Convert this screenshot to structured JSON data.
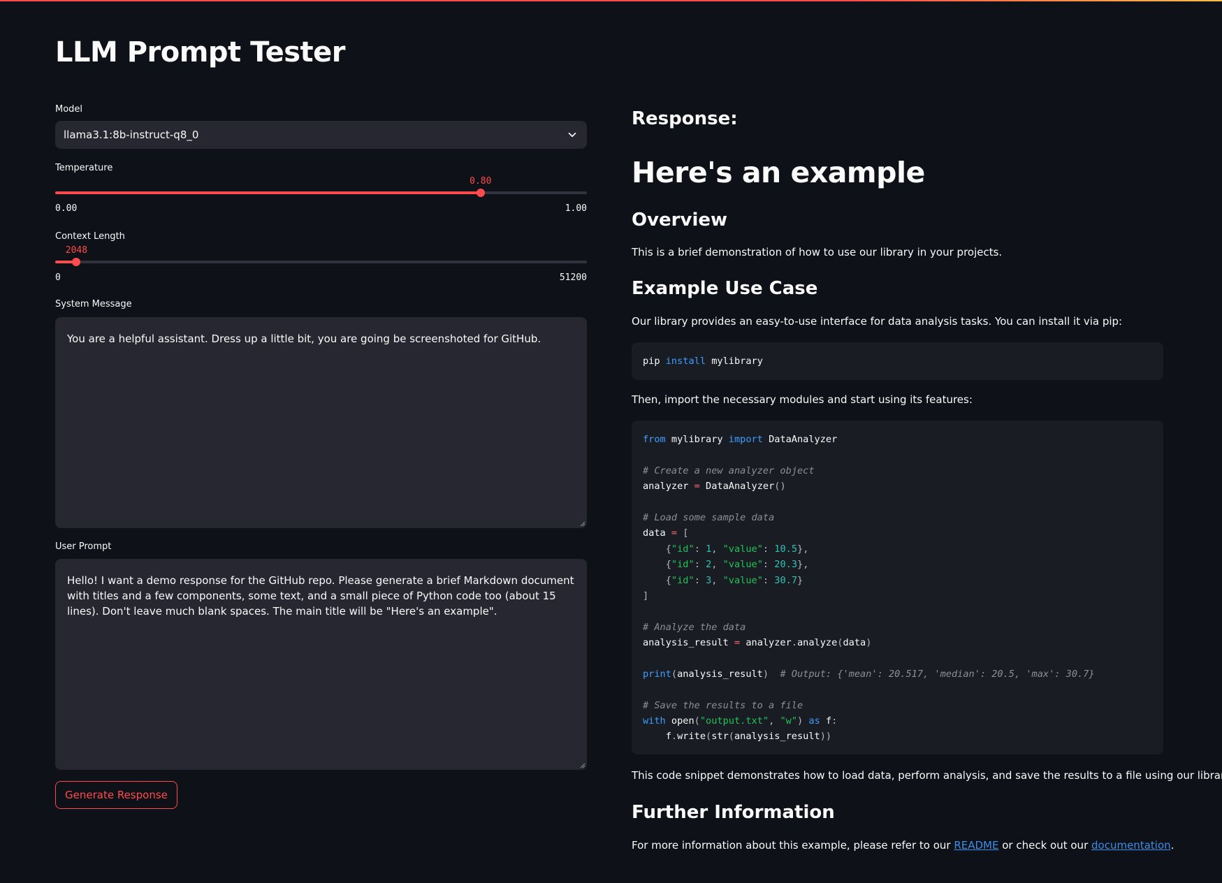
{
  "app": {
    "title": "LLM Prompt Tester"
  },
  "model": {
    "label": "Model",
    "selected": "llama3.1:8b-instruct-q8_0"
  },
  "temperature": {
    "label": "Temperature",
    "value_text": "0.80",
    "value": 0.8,
    "min_text": "0.00",
    "max_text": "1.00",
    "min": 0,
    "max": 1
  },
  "context_length": {
    "label": "Context Length",
    "value_text": "2048",
    "value": 2048,
    "min_text": "0",
    "max_text": "51200",
    "min": 0,
    "max": 51200
  },
  "system_message": {
    "label": "System Message",
    "value": "You are a helpful assistant. Dress up a little bit, you are going be screenshoted for GitHub."
  },
  "user_prompt": {
    "label": "User Prompt",
    "value": "Hello! I want a demo response for the GitHub repo. Please generate a brief Markdown document with titles and a few components, some text, and a small piece of Python code too (about 15 lines). Don't leave much blank spaces. The main title will be \"Here's an example\"."
  },
  "generate_button": {
    "label": "Generate Response"
  },
  "response": {
    "label": "Response:",
    "h1": "Here's an example",
    "overview_heading": "Overview",
    "overview_text": "This is a brief demonstration of how to use our library in your projects.",
    "usecase_heading": "Example Use Case",
    "usecase_text": "Our library provides an easy-to-use interface for data analysis tasks. You can install it via pip:",
    "pip_cmd": {
      "cmd": "pip",
      "sub": "install",
      "pkg": "mylibrary"
    },
    "import_text": "Then, import the necessary modules and start using its features:",
    "code_lines": [
      "from mylibrary import DataAnalyzer",
      "",
      "# Create a new analyzer object",
      "analyzer = DataAnalyzer()",
      "",
      "# Load some sample data",
      "data = [",
      "    {\"id\": 1, \"value\": 10.5},",
      "    {\"id\": 2, \"value\": 20.3},",
      "    {\"id\": 3, \"value\": 30.7}",
      "]",
      "",
      "# Analyze the data",
      "analysis_result = analyzer.analyze(data)",
      "",
      "print(analysis_result)  # Output: {'mean': 20.517, 'median': 20.5, 'max': 30.7}",
      "",
      "# Save the results to a file",
      "with open(\"output.txt\", \"w\") as f:",
      "    f.write(str(analysis_result))"
    ],
    "snippet_text": "This code snippet demonstrates how to load data, perform analysis, and save the results to a file using our library.",
    "further_heading": "Further Information",
    "further_text_before": "For more information about this example, please refer to our ",
    "readme_link": "README",
    "further_text_middle": " or check out our ",
    "docs_link": "documentation",
    "further_text_after": "."
  },
  "colors": {
    "background": "#0e1117",
    "accent": "#ff4b4b",
    "input_bg": "#262730",
    "link": "#3b8eea"
  },
  "icons": {
    "select": "chevron-down-icon",
    "resize": "resize-grip-icon"
  }
}
